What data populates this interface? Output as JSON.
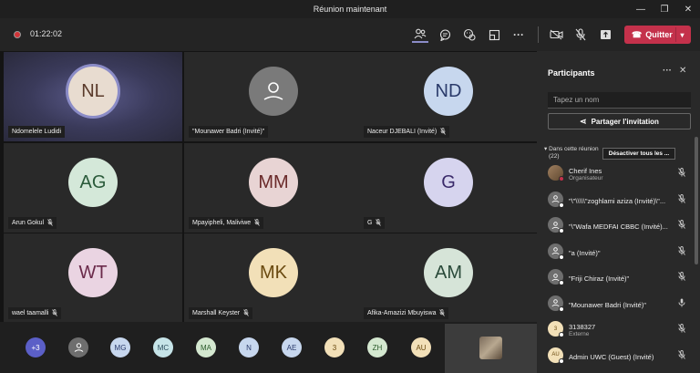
{
  "window": {
    "title": "Réunion maintenant"
  },
  "toolbar": {
    "timer": "01:22:02",
    "quit_label": "Quitter"
  },
  "tiles": [
    {
      "initials": "NL",
      "name": "Ndomelele Ludidi",
      "bg": "#e8dcd0",
      "fg": "#5a3a2a",
      "speaking": true,
      "mic": ""
    },
    {
      "initials": "",
      "name": "\"Mounawer Badri (Invité)\"",
      "bg": "#7a7a7a",
      "fg": "#fff",
      "generic": true,
      "mic": ""
    },
    {
      "initials": "ND",
      "name": "Naceur DJEBALI (Invité)",
      "bg": "#c7d7ee",
      "fg": "#2a3a6a",
      "mic": "🎙"
    },
    {
      "initials": "AG",
      "name": "Arun Gokul",
      "bg": "#d4e8d9",
      "fg": "#2a5a3a",
      "mic": "🎙"
    },
    {
      "initials": "MM",
      "name": "Mpayipheli, Maliviwe",
      "bg": "#e8d4d4",
      "fg": "#6a2a2a",
      "mic": "🎙"
    },
    {
      "initials": "G",
      "name": "G",
      "bg": "#d6d4ee",
      "fg": "#3a2a6a",
      "mic": "🎙"
    },
    {
      "initials": "WT",
      "name": "wael taamalli",
      "bg": "#ead4e2",
      "fg": "#6a2a4a",
      "mic": "🎙"
    },
    {
      "initials": "MK",
      "name": "Marshall Keyster",
      "bg": "#f2e0b8",
      "fg": "#6a4a10",
      "mic": "🎙"
    },
    {
      "initials": "AM",
      "name": "Afika-Amazizi Mbuyiswa",
      "bg": "#d6e4d8",
      "fg": "#2a4a3a",
      "mic": "🎙"
    }
  ],
  "strip": [
    {
      "label": "+3",
      "bg": "#5b5fc7",
      "fg": "#fff"
    },
    {
      "label": "",
      "bg": "#6e6e6e",
      "fg": "#fff",
      "generic": true
    },
    {
      "label": "MG",
      "bg": "#c7d7ee",
      "fg": "#2a3a6a"
    },
    {
      "label": "MC",
      "bg": "#c6e4e8",
      "fg": "#2a4a5a"
    },
    {
      "label": "MA",
      "bg": "#d4e8d0",
      "fg": "#2a5a2a"
    },
    {
      "label": "N",
      "bg": "#c7d7ee",
      "fg": "#2a3a6a"
    },
    {
      "label": "AE",
      "bg": "#c7d7ee",
      "fg": "#2a3a6a"
    },
    {
      "label": "3",
      "bg": "#f2e0b8",
      "fg": "#6a4a10"
    },
    {
      "label": "ZH",
      "bg": "#d4e8d0",
      "fg": "#2a5a2a"
    },
    {
      "label": "AU",
      "bg": "#f2e0b8",
      "fg": "#6a4a10"
    }
  ],
  "panel": {
    "title": "Participants",
    "search_placeholder": "Tapez un nom",
    "share_label": "Partager l'invitation",
    "group_label_1": "Dans cette réunion",
    "group_label_2": "(22)",
    "mute_all_label": "Désactiver tous les ...",
    "people": [
      {
        "name": "Cherif Ines",
        "role": "Organisateur",
        "avatar": "photo",
        "mic": "muted"
      },
      {
        "name": "\"\\\"\\\\\\\\\\\"zoghlami aziza (Invité)\\\"...",
        "role": "",
        "avatar": "generic",
        "mic": "muted"
      },
      {
        "name": "\"\\\"Wafa MEDFAI CBBC (Invité)...",
        "role": "",
        "avatar": "generic",
        "mic": "muted"
      },
      {
        "name": "\"a (Invité)\"",
        "role": "",
        "avatar": "generic",
        "mic": "muted"
      },
      {
        "name": "\"Friji Chiraz (Invité)\"",
        "role": "",
        "avatar": "generic",
        "mic": "muted"
      },
      {
        "name": "\"Mounawer Badri (Invité)\"",
        "role": "",
        "avatar": "generic",
        "mic": "on"
      },
      {
        "name": "3138327",
        "role": "Externe",
        "avatar": "3",
        "mic": "muted"
      },
      {
        "name": "Admin UWC (Guest) (Invité)",
        "role": "",
        "avatar": "AU",
        "mic": "muted"
      }
    ]
  },
  "colors": {
    "accent": "#8b8cc7",
    "quit": "#c4314b",
    "rec": "#d13438"
  }
}
